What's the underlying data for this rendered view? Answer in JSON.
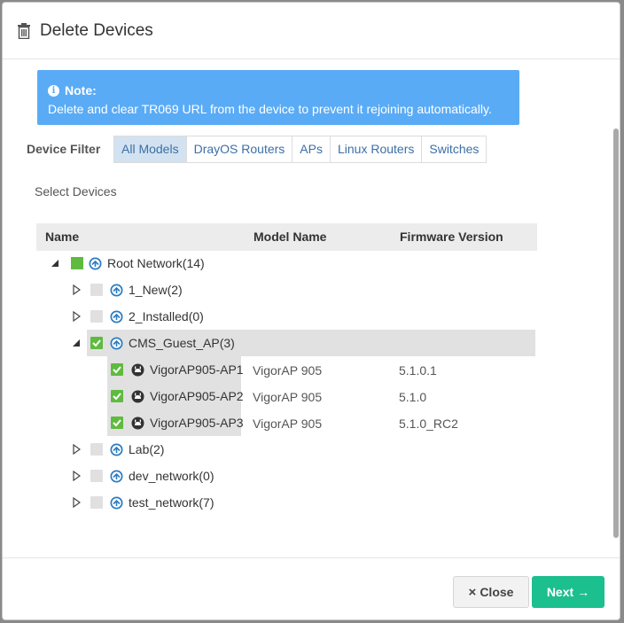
{
  "dialog": {
    "title": "Delete Devices",
    "title_icon": "trash-icon"
  },
  "note": {
    "title": "Note:",
    "message": "Delete and clear TR069 URL from the device to prevent it rejoining automatically."
  },
  "filter": {
    "label": "Device Filter",
    "tabs": [
      "All Models",
      "DrayOS Routers",
      "APs",
      "Linux Routers",
      "Switches"
    ],
    "active_tab": "All Models"
  },
  "select_label": "Select Devices",
  "table": {
    "columns": {
      "name": "Name",
      "model": "Model Name",
      "firmware": "Firmware Version"
    },
    "rows": [
      {
        "label": "Root Network(14)",
        "expander": "expanded",
        "check": "partial",
        "icon": "network-icon"
      },
      {
        "label": "1_New(2)",
        "expander": "collapsed",
        "check": "unchecked",
        "icon": "network-icon"
      },
      {
        "label": "2_Installed(0)",
        "expander": "collapsed",
        "check": "unchecked",
        "icon": "network-icon"
      },
      {
        "label": "CMS_Guest_AP(3)",
        "expander": "expanded",
        "check": "checked",
        "icon": "network-icon",
        "selected": true
      },
      {
        "label": "VigorAP905-AP1",
        "model": "VigorAP 905",
        "firmware": "5.1.0.1",
        "check": "checked",
        "icon": "ap-icon"
      },
      {
        "label": "VigorAP905-AP2",
        "model": "VigorAP 905",
        "firmware": "5.1.0",
        "check": "checked",
        "icon": "ap-icon"
      },
      {
        "label": "VigorAP905-AP3",
        "model": "VigorAP 905",
        "firmware": "5.1.0_RC2",
        "check": "checked",
        "icon": "ap-icon"
      },
      {
        "label": "Lab(2)",
        "expander": "collapsed",
        "check": "unchecked",
        "icon": "network-icon"
      },
      {
        "label": "dev_network(0)",
        "expander": "collapsed",
        "check": "unchecked",
        "icon": "network-icon"
      },
      {
        "label": "test_network(7)",
        "expander": "collapsed",
        "check": "unchecked",
        "icon": "network-icon"
      }
    ]
  },
  "footer": {
    "close_label": "Close",
    "next_label": "Next"
  },
  "colors": {
    "note_bg": "#5aabf6",
    "check_green": "#5fbb3f",
    "next_green": "#1cbf8e",
    "network_icon_blue": "#2b7bc1",
    "tab_active_bg": "#d3e2f1"
  }
}
